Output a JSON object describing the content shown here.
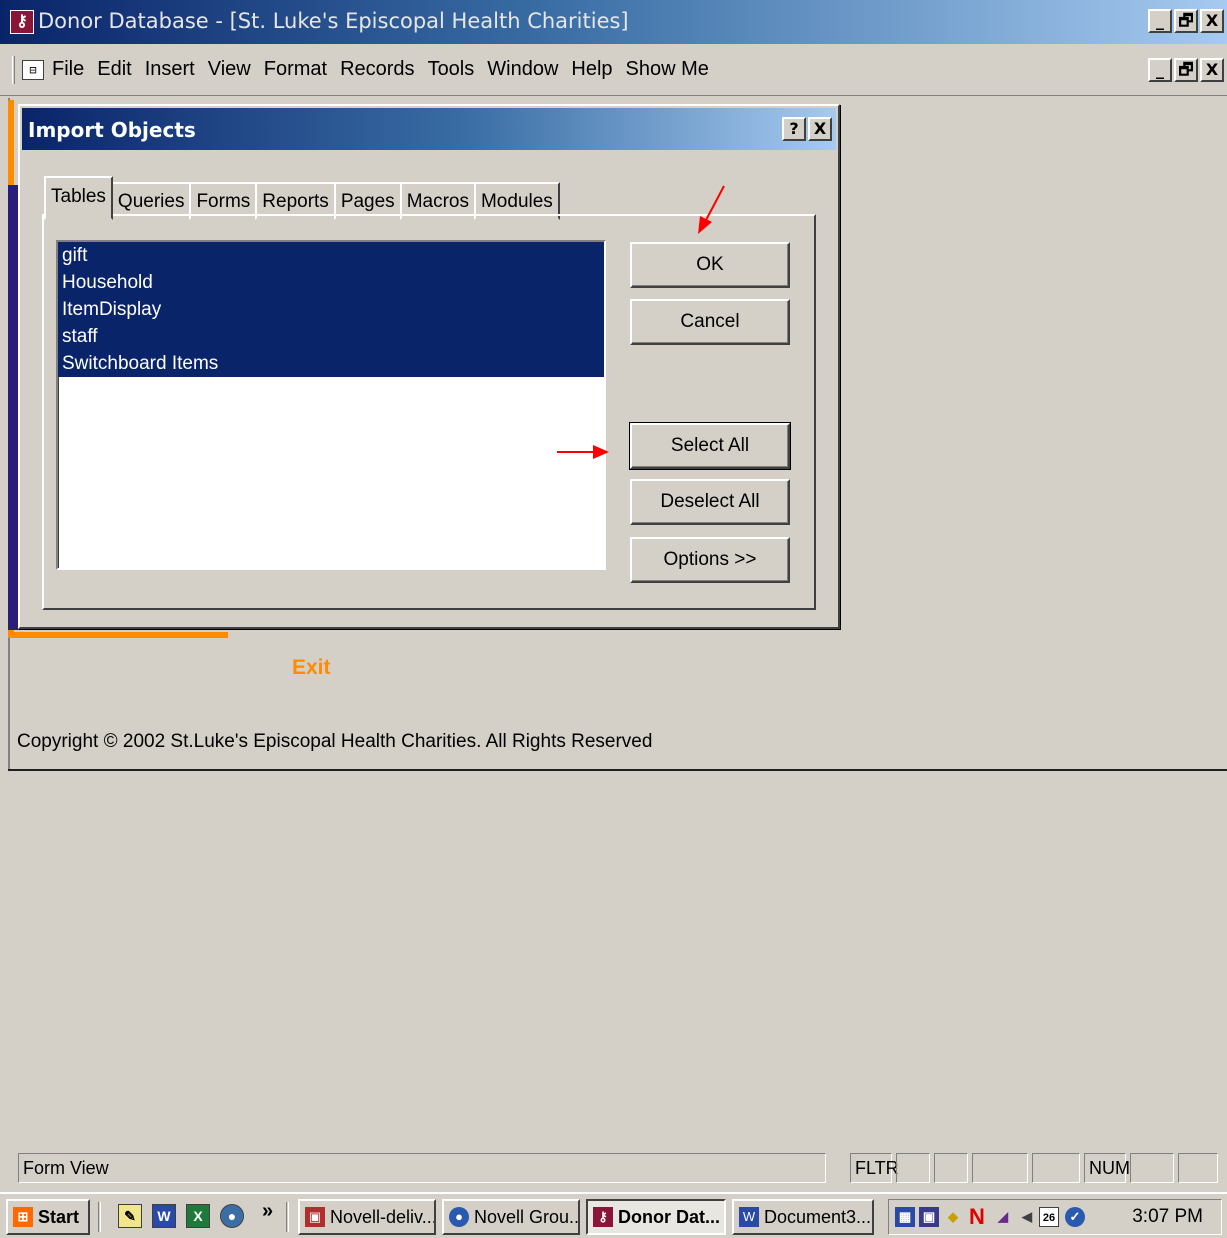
{
  "window": {
    "title": "Donor Database - [St. Luke's Episcopal Health Charities]",
    "minimize": "_",
    "restore": "🗗",
    "close": "X"
  },
  "menubar": {
    "items": [
      "File",
      "Edit",
      "Insert",
      "View",
      "Format",
      "Records",
      "Tools",
      "Window",
      "Help",
      "Show Me"
    ]
  },
  "form": {
    "exit_label": "Exit",
    "copyright": "Copyright © 2002 St.Luke's Episcopal Health Charities. All Rights Reserved"
  },
  "dialog": {
    "title": "Import Objects",
    "help": "?",
    "close": "X",
    "tabs": [
      "Tables",
      "Queries",
      "Forms",
      "Reports",
      "Pages",
      "Macros",
      "Modules"
    ],
    "active_tab": "Tables",
    "items": [
      "gift",
      "Household",
      "ItemDisplay",
      "staff",
      "Switchboard Items"
    ],
    "buttons": {
      "ok": "OK",
      "cancel": "Cancel",
      "select_all": "Select All",
      "deselect_all": "Deselect All",
      "options": "Options >>"
    }
  },
  "statusbar": {
    "mode": "Form View",
    "fltr": "FLTR",
    "num": "NUM"
  },
  "taskbar": {
    "start": "Start",
    "more": "»",
    "tasks": [
      "Novell-deliv...",
      "Novell Grou...",
      "Donor Dat...",
      "Document3..."
    ],
    "active_task": "Donor Dat...",
    "clock": "3:07 PM",
    "tray_date": "26"
  },
  "colors": {
    "selection": "#0a246a",
    "accent_orange": "#ff8c00",
    "accent_purple": "#2a1e7a",
    "annotation_arrow": "#ff0000"
  }
}
